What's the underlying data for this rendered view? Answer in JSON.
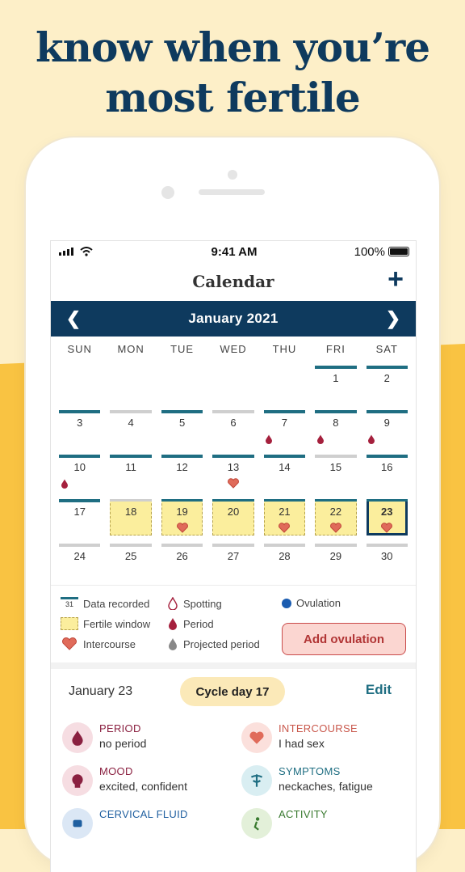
{
  "headline": {
    "line1": "know when you’re",
    "line2": "most fertile"
  },
  "status": {
    "time": "9:41 AM",
    "battery": "100%"
  },
  "nav": {
    "title": "Calendar",
    "add_icon": "plus-icon"
  },
  "month": {
    "title": "January 2021",
    "prev_icon": "chevron-left-icon",
    "next_icon": "chevron-right-icon"
  },
  "weekdays": [
    "SUN",
    "MON",
    "TUE",
    "WED",
    "THU",
    "FRI",
    "SAT"
  ],
  "weeks": [
    [
      {
        "d": ""
      },
      {
        "d": ""
      },
      {
        "d": ""
      },
      {
        "d": ""
      },
      {
        "d": ""
      },
      {
        "d": "1",
        "bar": "data"
      },
      {
        "d": "2",
        "bar": "data"
      }
    ],
    [
      {
        "d": "3",
        "bar": "data"
      },
      {
        "d": "4",
        "bar": "grey"
      },
      {
        "d": "5",
        "bar": "data"
      },
      {
        "d": "6",
        "bar": "grey"
      },
      {
        "d": "7",
        "bar": "data",
        "mark": "period"
      },
      {
        "d": "8",
        "bar": "data",
        "mark": "period"
      },
      {
        "d": "9",
        "bar": "data",
        "mark": "period"
      }
    ],
    [
      {
        "d": "10",
        "bar": "data",
        "mark": "period"
      },
      {
        "d": "11",
        "bar": "data"
      },
      {
        "d": "12",
        "bar": "data"
      },
      {
        "d": "13",
        "bar": "data",
        "mark": "heart"
      },
      {
        "d": "14",
        "bar": "data"
      },
      {
        "d": "15",
        "bar": "grey"
      },
      {
        "d": "16",
        "bar": "data"
      }
    ],
    [
      {
        "d": "17",
        "bar": "data"
      },
      {
        "d": "18",
        "fertile": true
      },
      {
        "d": "19",
        "fertile": true,
        "mark": "heart"
      },
      {
        "d": "20",
        "fertile": true
      },
      {
        "d": "21",
        "fertile": true,
        "mark": "heart"
      },
      {
        "d": "22",
        "fertile": true,
        "mark": "heart"
      },
      {
        "d": "23",
        "fertile": true,
        "selected": true,
        "mark": "heart"
      }
    ],
    [
      {
        "d": "24",
        "bar": "grey"
      },
      {
        "d": "25",
        "bar": "grey"
      },
      {
        "d": "26",
        "bar": "grey"
      },
      {
        "d": "27",
        "bar": "grey"
      },
      {
        "d": "28",
        "bar": "grey"
      },
      {
        "d": "29",
        "bar": "grey"
      },
      {
        "d": "30",
        "bar": "grey"
      }
    ]
  ],
  "legend": {
    "data_recorded": "Data recorded",
    "data_recorded_sample": "31",
    "fertile_window": "Fertile window",
    "intercourse": "Intercourse",
    "spotting": "Spotting",
    "period": "Period",
    "projected_period": "Projected period",
    "ovulation": "Ovulation",
    "add_ovulation": "Add ovulation"
  },
  "day": {
    "date": "January 23",
    "cycle_day": "Cycle day 17",
    "edit": "Edit"
  },
  "details": [
    {
      "key": "PERIOD",
      "value": "no period",
      "color": "#8a2040",
      "bg": "#f6dde2",
      "icon": "drop-icon"
    },
    {
      "key": "INTERCOURSE",
      "value": "I had sex",
      "color": "#c9584c",
      "bg": "#fbe0dc",
      "icon": "heart-icon"
    },
    {
      "key": "MOOD",
      "value": "excited, confident",
      "color": "#8a2040",
      "bg": "#f6dde2",
      "icon": "head-icon"
    },
    {
      "key": "SYMPTOMS",
      "value": "neckaches, fatigue",
      "color": "#1f6e82",
      "bg": "#d9eef2",
      "icon": "caduceus-icon"
    },
    {
      "key": "CERVICAL FLUID",
      "value": "",
      "color": "#1f5fa0",
      "bg": "#dbe7f5",
      "icon": "fluid-icon"
    },
    {
      "key": "ACTIVITY",
      "value": "",
      "color": "#3a7a30",
      "bg": "#e3f0d9",
      "icon": "activity-icon"
    }
  ],
  "colors": {
    "navy": "#0e3a5e",
    "teal": "#1f6e82",
    "fertile": "#fbee9d",
    "heart": "#e06b5a",
    "period": "#a5203d"
  }
}
